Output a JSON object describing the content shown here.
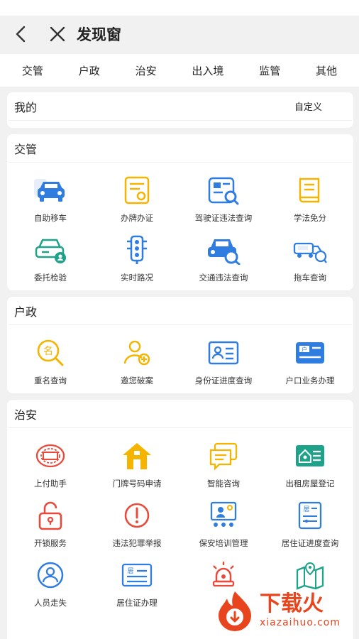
{
  "header": {
    "title": "发现窗"
  },
  "tabs": [
    "交管",
    "户政",
    "治安",
    "出入境",
    "监管",
    "其他"
  ],
  "mine": {
    "title": "我的",
    "custom_label": "自定义"
  },
  "sections": [
    {
      "title": "交管",
      "items": [
        {
          "label": "自助移车",
          "icon": "car-icon"
        },
        {
          "label": "办牌办证",
          "icon": "license-card-icon"
        },
        {
          "label": "驾驶证违法查询",
          "icon": "license-search-icon"
        },
        {
          "label": "学法免分",
          "icon": "book-icon"
        },
        {
          "label": "委托检验",
          "icon": "car-inspection-icon"
        },
        {
          "label": "实时路况",
          "icon": "traffic-light-icon"
        },
        {
          "label": "交通违法查询",
          "icon": "car-search-icon"
        },
        {
          "label": "拖车查询",
          "icon": "tow-truck-icon"
        }
      ]
    },
    {
      "title": "户政",
      "items": [
        {
          "label": "重名查询",
          "icon": "name-search-icon"
        },
        {
          "label": "邀您破案",
          "icon": "person-add-icon"
        },
        {
          "label": "身份证进度查询",
          "icon": "id-card-icon"
        },
        {
          "label": "户口业务办理",
          "icon": "household-card-icon"
        }
      ]
    },
    {
      "title": "治安",
      "items": [
        {
          "label": "上付助手",
          "icon": "stamp-icon"
        },
        {
          "label": "门牌号码申请",
          "icon": "house-icon"
        },
        {
          "label": "智能咨询",
          "icon": "chat-icon"
        },
        {
          "label": "出租房屋登记",
          "icon": "rental-house-icon"
        },
        {
          "label": "开锁服务",
          "icon": "lock-icon"
        },
        {
          "label": "违法犯罪举报",
          "icon": "alert-icon"
        },
        {
          "label": "保安培训管理",
          "icon": "training-icon"
        },
        {
          "label": "居住证进度查询",
          "icon": "residence-progress-icon"
        },
        {
          "label": "人员走失",
          "icon": "missing-person-icon"
        },
        {
          "label": "居住证办理",
          "icon": "residence-card-icon"
        },
        {
          "label": "",
          "icon": "siren-icon"
        },
        {
          "label": "",
          "icon": "map-pin-icon"
        }
      ]
    }
  ],
  "watermark": {
    "brand": "下载火",
    "site": "xiazaihuo.com"
  },
  "colors": {
    "blue": "#2f7de1",
    "yellow": "#f5b400",
    "green": "#1fa28a",
    "red": "#e84b3c"
  }
}
